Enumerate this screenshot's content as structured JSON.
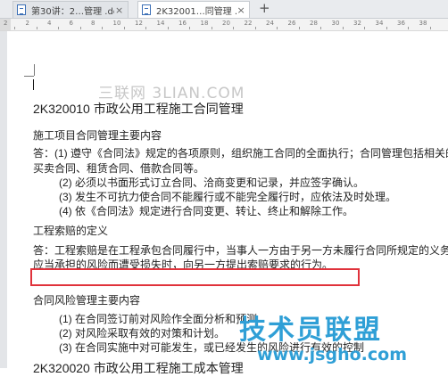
{
  "tabs": [
    {
      "label": "第30讲：2…管理 .doc",
      "close": "×"
    },
    {
      "label": "2K32001…同管理 .doc",
      "close": "×"
    }
  ],
  "tab_add": "+",
  "ruler": [
    "2",
    "2",
    "4",
    "6",
    "8",
    "10",
    "12",
    "14",
    "16",
    "18",
    "20",
    "22",
    "24",
    "26",
    "28",
    "30",
    "32",
    "34",
    "36",
    "38"
  ],
  "watermark": "三联网 3LIAN.COM",
  "document": {
    "title": "2K320010    市政公用工程施工合同管理",
    "section1_heading": "施工项目合同管理主要内容",
    "lines1": [
      "答：(1) 遵守《合同法》规定的各项原则，组织施工合同的全面执行；合同管理包括相关的",
      "买卖合同、租赁合同、借款合同等。",
      "(2) 必须以书面形式订立合同、洽商变更和记录，并应签字确认。",
      "(3) 发生不可抗力使合同不能履行或不能完全履行时，应依法及时处理。",
      "(4) 依《合同法》规定进行合同变更、转让、终止和解除工作。"
    ],
    "section2_heading": "工程索赔的定义",
    "lines2": [
      "答：工程索赔是在工程承包合同履行中，当事人一方由于另一方未履行合同所规定的义务或",
      "应当承担的风险而遭受损失时，向另一方提出索赔要求的行为。"
    ],
    "section3_heading": "合同风险管理主要内容",
    "lines3": [
      "(1) 在合同签订前对风险作全面分析和预测",
      "(2) 对风险采取有效的对策和计划。",
      "(3) 在合同实施中对可能发生，或已经发生的风险进行有效的控制"
    ],
    "next_title": "2K320020    市政公用工程施工成本管理"
  },
  "logo": {
    "text": "技术员联盟",
    "url": "www.jsgho.com"
  },
  "colors": {
    "highlight": "#e0323b",
    "logo": "#2f9fd6",
    "watermark": "#c7c7c7"
  }
}
